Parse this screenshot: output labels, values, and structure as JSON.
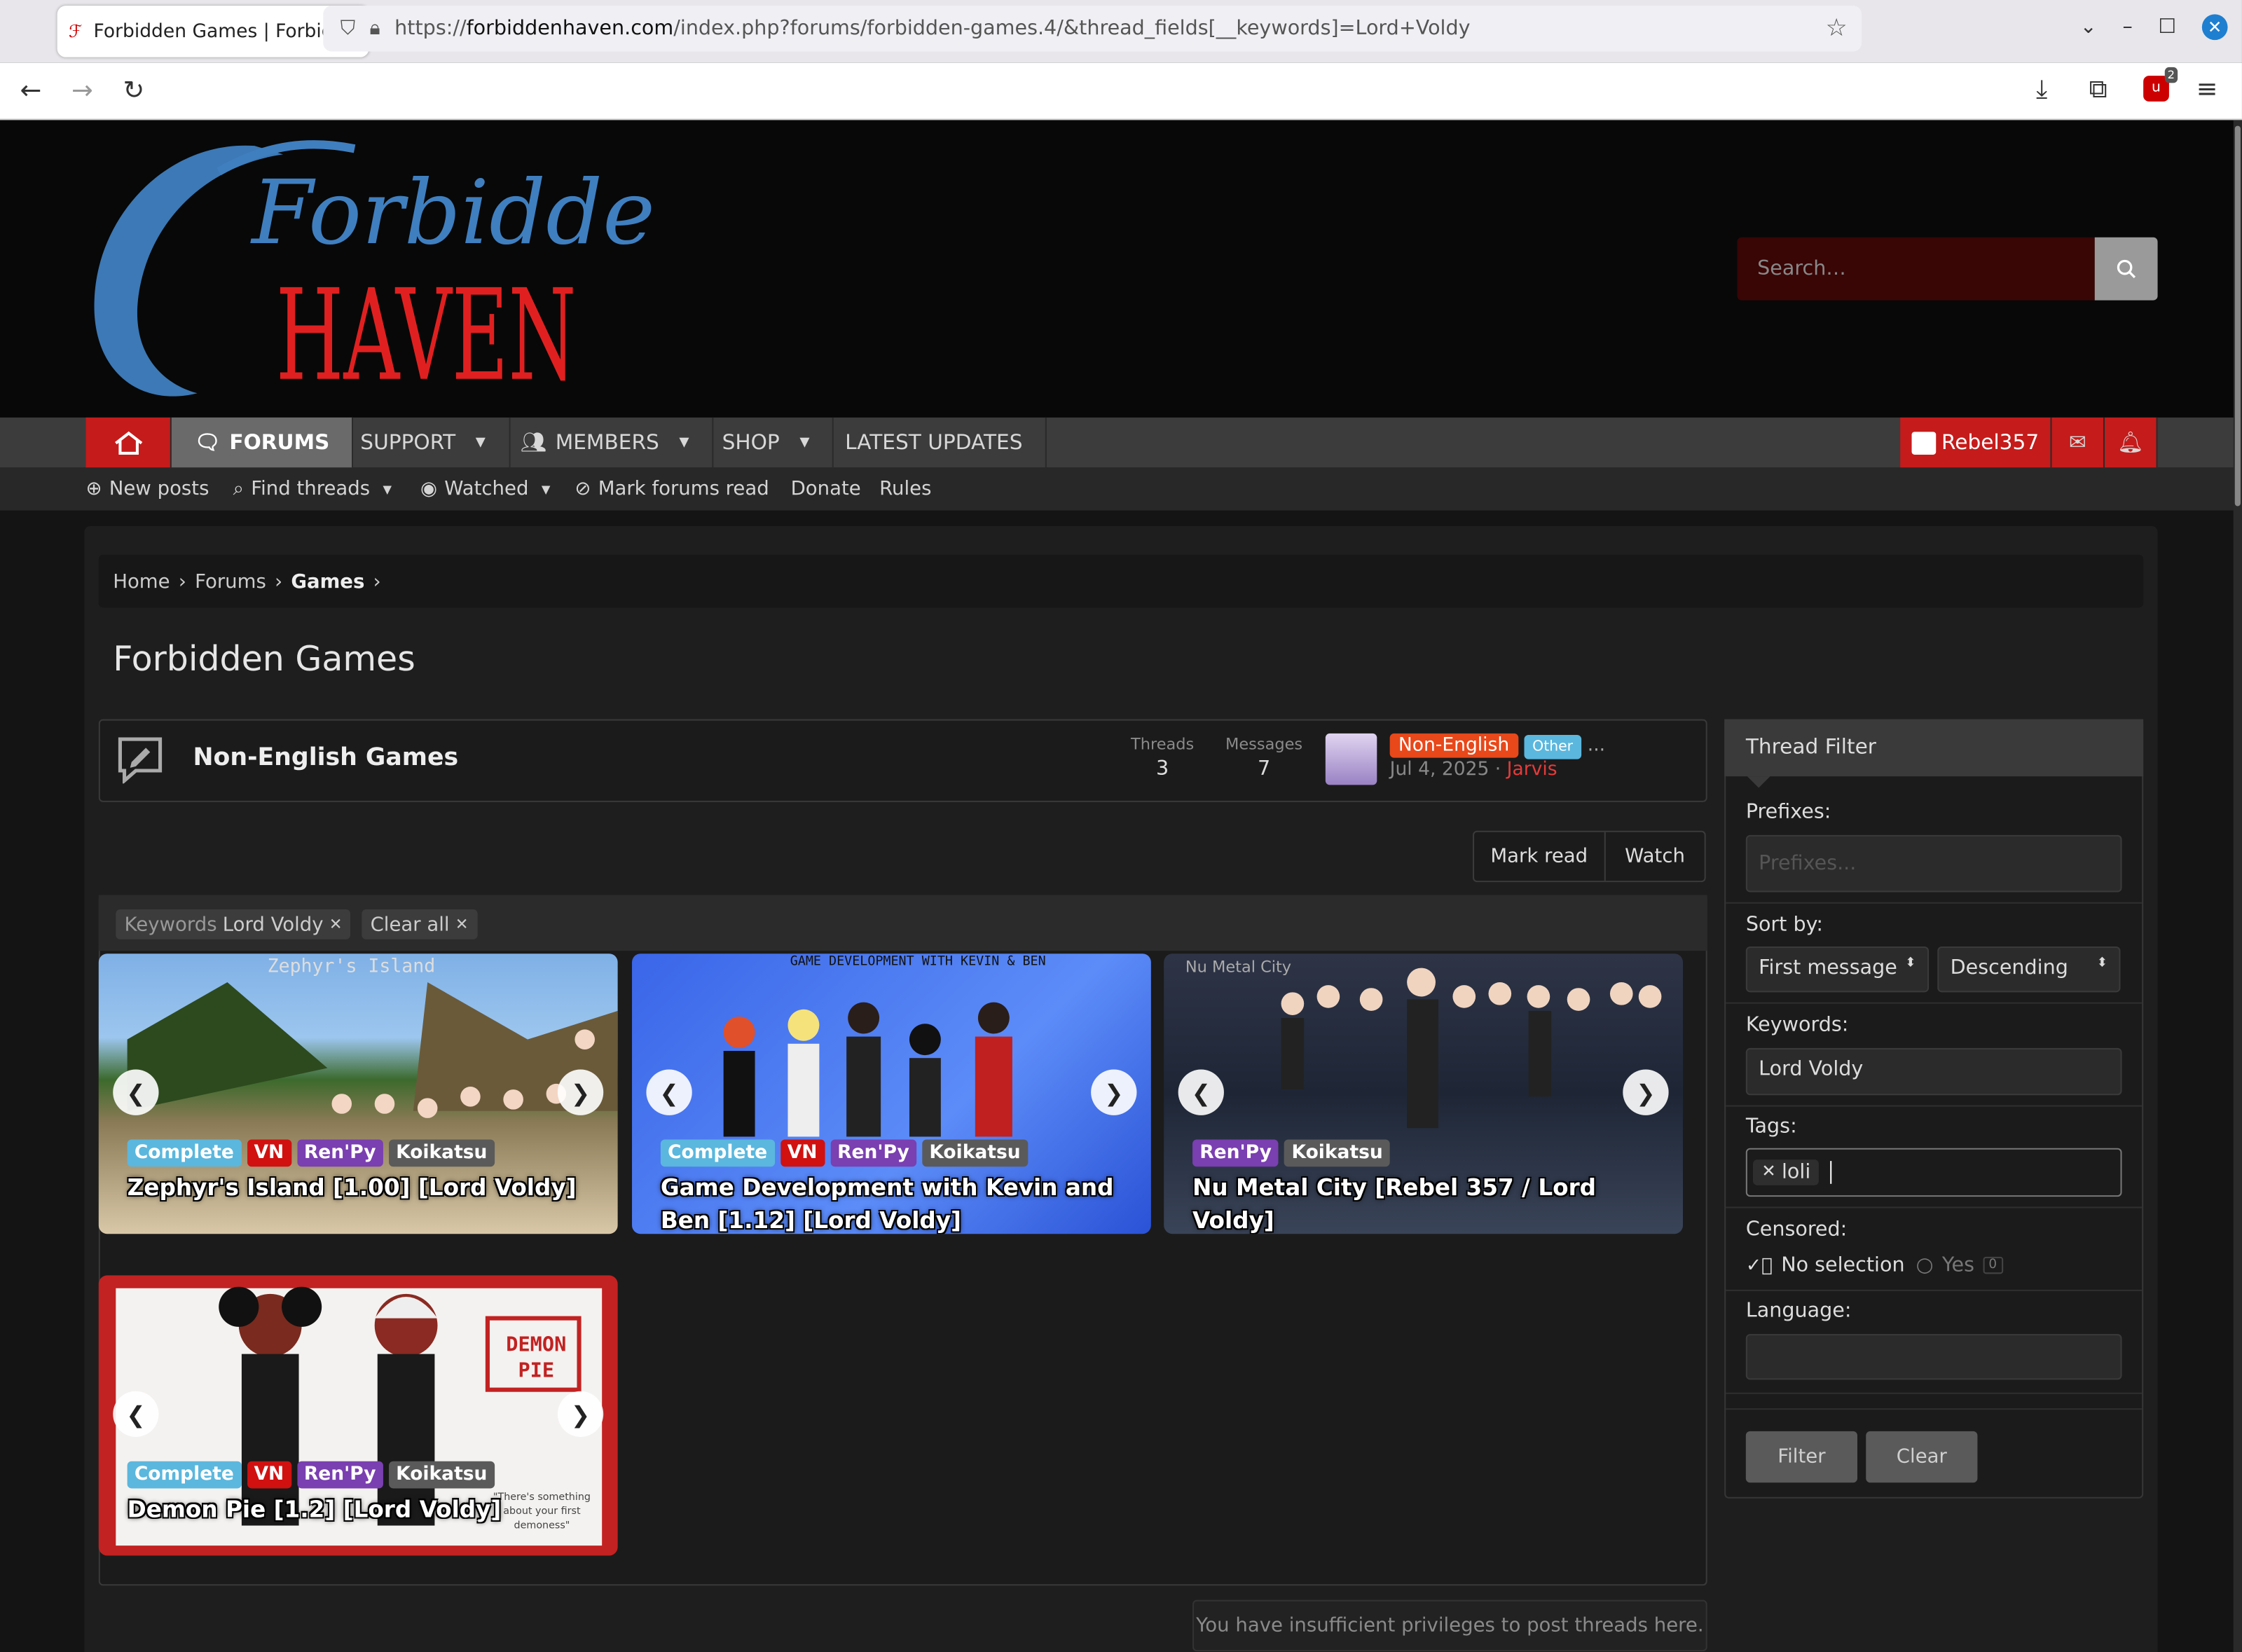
{
  "browser": {
    "tab_title": "Forbidden Games | Forbidde",
    "url_domain": "forbiddenhaven.com",
    "url_prefix": "https://",
    "url_path": "/index.php?forums/forbidden-games.4/&thread_fields[__keywords]=Lord+Voldy",
    "download_badge": "2"
  },
  "site": {
    "logo_top": "Forbidden",
    "logo_bottom": "HAVEN",
    "search_placeholder": "Search…"
  },
  "nav": {
    "forums": "FORUMS",
    "support": "SUPPORT",
    "members": "MEMBERS",
    "shop": "SHOP",
    "latest": "LATEST UPDATES",
    "user": "Rebel357"
  },
  "subnav": {
    "new_posts": "New posts",
    "find_threads": "Find threads",
    "watched": "Watched",
    "mark_read": "Mark forums read",
    "donate": "Donate",
    "rules": "Rules"
  },
  "breadcrumb": [
    "Home",
    "Forums",
    "Games"
  ],
  "page_title": "Forbidden Games",
  "node": {
    "title": "Non-English Games",
    "threads_label": "Threads",
    "threads": "3",
    "messages_label": "Messages",
    "messages": "7",
    "prefix": "Non-English",
    "prefix2": "Other",
    "ellipsis": "...",
    "date": "Jul 4, 2025",
    "author": "Jarvis"
  },
  "buttons": {
    "mark_read": "Mark read",
    "watch": "Watch"
  },
  "filters": {
    "keywords_label": "Keywords",
    "keywords_value": "Lord Voldy",
    "clear_all": "Clear all"
  },
  "threads": [
    {
      "title": "Zephyr's Island [1.00] [Lord Voldy]",
      "prefixes": [
        "Complete",
        "VN",
        "Ren'Py",
        "Koikatsu"
      ],
      "banner": "Zephyr's Island"
    },
    {
      "title": "Game Development with Kevin and Ben [1.12] [Lord Voldy]",
      "prefixes": [
        "Complete",
        "VN",
        "Ren'Py",
        "Koikatsu"
      ],
      "banner": "GAME DEVELOPMENT WITH KEVIN & BEN"
    },
    {
      "title": "Nu Metal City [Rebel 357 / Lord Voldy]",
      "prefixes": [
        "Ren'Py",
        "Koikatsu"
      ],
      "banner": "Nu Metal City"
    },
    {
      "title": "Demon Pie [1.2] [Lord Voldy]",
      "prefixes": [
        "Complete",
        "VN",
        "Ren'Py",
        "Koikatsu"
      ],
      "banner": "DEMON PIE",
      "quote": "\"There's something about your first demoness\""
    }
  ],
  "notice": "You have insufficient privileges to post threads here.",
  "sidebar": {
    "title": "Thread Filter",
    "prefixes_label": "Prefixes:",
    "prefixes_placeholder": "Prefixes...",
    "sort_label": "Sort by:",
    "sort_field": "First message",
    "sort_dir": "Descending",
    "keywords_label": "Keywords:",
    "keywords_value": "Lord Voldy",
    "tags_label": "Tags:",
    "tag": "loli",
    "censored_label": "Censored:",
    "opt_none": "No selection",
    "opt_yes": "Yes",
    "opt_yes_count": "0",
    "language_label": "Language:",
    "filter_btn": "Filter",
    "clear_btn": "Clear"
  },
  "colors": {
    "accent": "#c51b1b",
    "logo_blue": "#3f7fc0",
    "logo_red": "#e02020"
  }
}
